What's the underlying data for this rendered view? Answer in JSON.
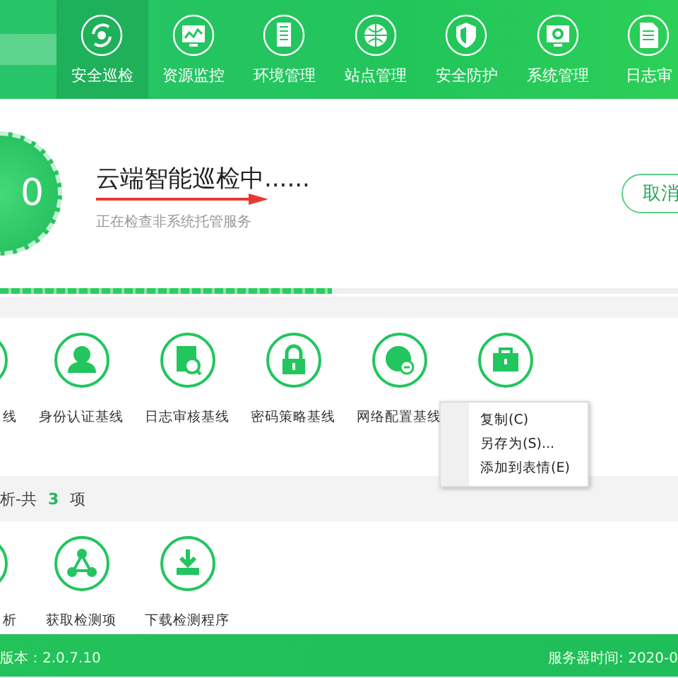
{
  "nav": {
    "tabs": [
      {
        "label": "安全巡检",
        "selected": true
      },
      {
        "label": "资源监控",
        "selected": false
      },
      {
        "label": "环境管理",
        "selected": false
      },
      {
        "label": "站点管理",
        "selected": false
      },
      {
        "label": "安全防护",
        "selected": false
      },
      {
        "label": "系统管理",
        "selected": false
      },
      {
        "label": "日志审",
        "selected": false
      }
    ]
  },
  "scan": {
    "score": "0",
    "title": "云端智能巡检中......",
    "subtitle": "正在检查非系统托管服务",
    "cancel": "取消",
    "level": 0.49
  },
  "baselines": [
    {
      "label": "线"
    },
    {
      "label": "身份认证基线"
    },
    {
      "label": "日志审核基线"
    },
    {
      "label": "密码策略基线"
    },
    {
      "label": "网络配置基线"
    }
  ],
  "tools_header": {
    "prefix": "析-共",
    "count": "3",
    "suffix": "项"
  },
  "tools": [
    {
      "label": "析"
    },
    {
      "label": "获取检测项"
    },
    {
      "label": "下载检测程序"
    }
  ],
  "context_menu": [
    "复制(C)",
    "另存为(S)...",
    "添加到表情(E)"
  ],
  "footer": {
    "version": "版本：2.0.7.10",
    "server_time": "服务器时间: 2020-0"
  }
}
